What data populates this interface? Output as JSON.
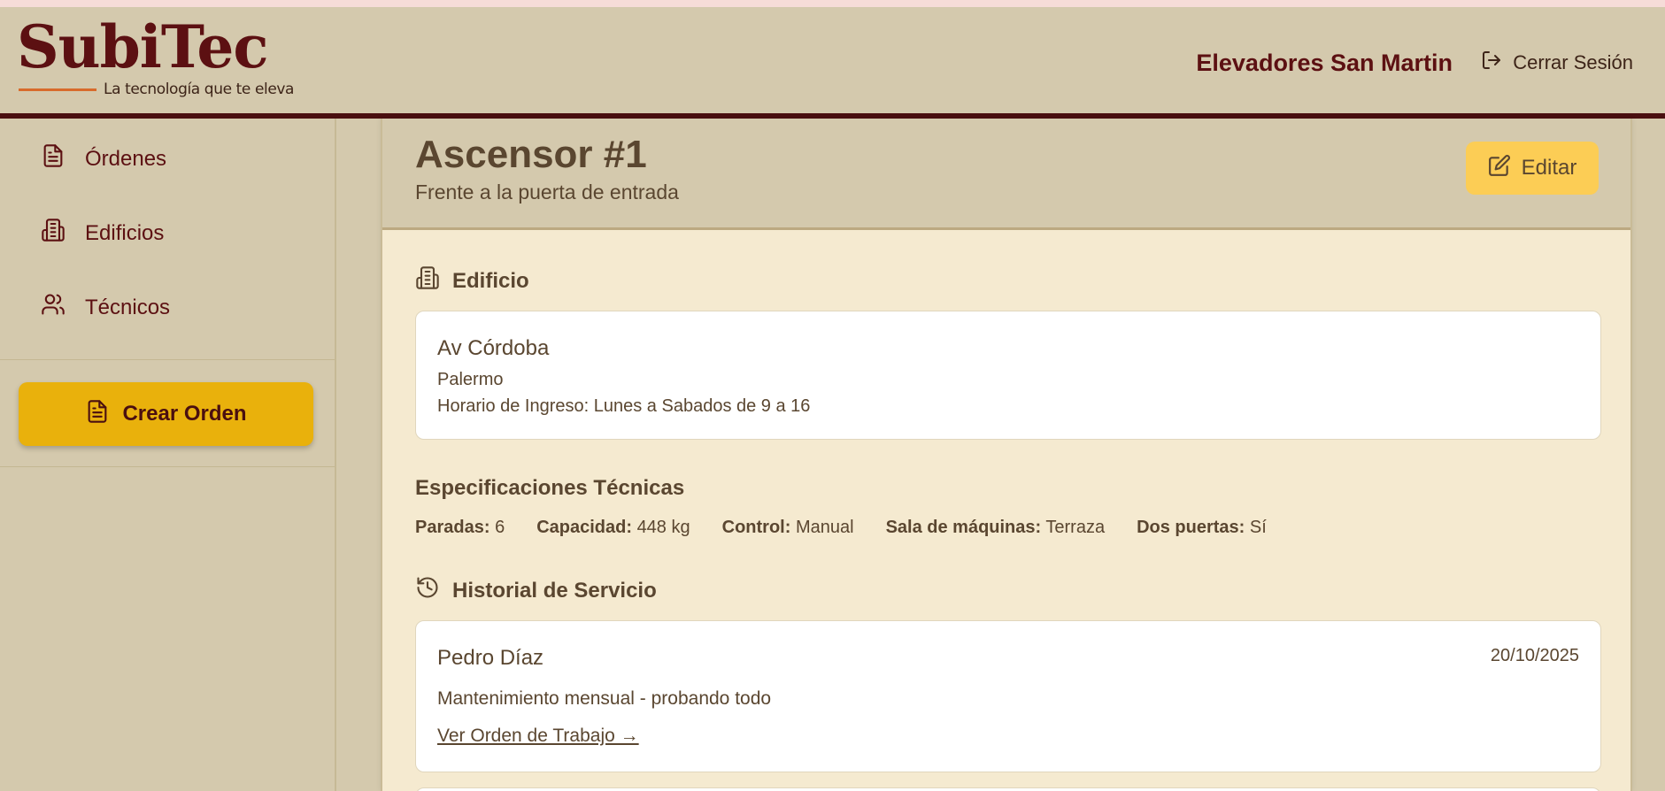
{
  "header": {
    "logo": "SubiTec",
    "tagline": "La tecnología que te eleva",
    "company": "Elevadores San Martin",
    "logout_label": "Cerrar Sesión"
  },
  "sidebar": {
    "items": [
      {
        "label": "Órdenes",
        "icon": "document-icon"
      },
      {
        "label": "Edificios",
        "icon": "building-icon"
      },
      {
        "label": "Técnicos",
        "icon": "users-icon"
      }
    ],
    "create_label": "Crear Orden"
  },
  "elevator": {
    "title": "Ascensor #1",
    "subtitle": "Frente a la puerta de entrada",
    "edit_label": "Editar"
  },
  "building": {
    "section_title": "Edificio",
    "name": "Av Córdoba",
    "neighborhood": "Palermo",
    "hours": "Horario de Ingreso: Lunes a Sabados de 9 a 16"
  },
  "specs": {
    "section_title": "Especificaciones Técnicas",
    "items": [
      {
        "label": "Paradas:",
        "value": "6"
      },
      {
        "label": "Capacidad:",
        "value": "448 kg"
      },
      {
        "label": "Control:",
        "value": "Manual"
      },
      {
        "label": "Sala de máquinas:",
        "value": "Terraza"
      },
      {
        "label": "Dos puertas:",
        "value": "Sí"
      }
    ]
  },
  "history": {
    "section_title": "Historial de Servicio",
    "entries": [
      {
        "technician": "Pedro Díaz",
        "date": "20/10/2025",
        "description": "Mantenimiento mensual - probando todo",
        "link_label": "Ver Orden de Trabajo →"
      }
    ]
  },
  "colors": {
    "brand_dark": "#5c1012",
    "accent_orange": "#d86b2c",
    "create_button": "#e9b10c",
    "edit_button": "#fccd55",
    "panel": "#d4c9ad",
    "card": "#f5ead0"
  }
}
